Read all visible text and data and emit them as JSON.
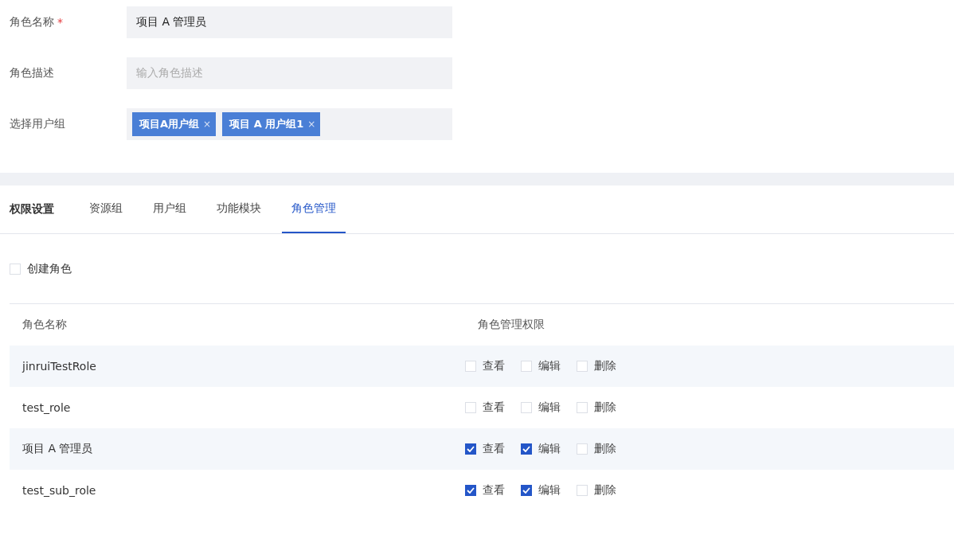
{
  "form": {
    "fields": [
      {
        "kind": "text",
        "label": "角色名称",
        "required_mark": "*",
        "value": "项目 A 管理员"
      },
      {
        "kind": "text",
        "label": "角色描述",
        "placeholder": "输入角色描述"
      },
      {
        "kind": "tags",
        "label": "选择用户组",
        "tags": [
          {
            "label": "项目A用户组",
            "remove": "×"
          },
          {
            "label": "项目 A 用户组1",
            "remove": "×"
          }
        ]
      }
    ]
  },
  "permissions": {
    "title": "权限设置",
    "tabs": [
      {
        "label": "资源组",
        "selected": false
      },
      {
        "label": "用户组",
        "selected": false
      },
      {
        "label": "功能模块",
        "selected": false
      },
      {
        "label": "角色管理",
        "selected": true
      }
    ],
    "create": {
      "label": "创建角色",
      "checked": false
    },
    "table": {
      "columns": [
        "角色名称",
        "角色管理权限"
      ],
      "rows": [
        {
          "name": "jinruiTestRole",
          "perms": [
            {
              "label": "查看",
              "checked": false
            },
            {
              "label": "编辑",
              "checked": false
            },
            {
              "label": "删除",
              "checked": false
            }
          ]
        },
        {
          "name": "test_role",
          "perms": [
            {
              "label": "查看",
              "checked": false
            },
            {
              "label": "编辑",
              "checked": false
            },
            {
              "label": "删除",
              "checked": false
            }
          ]
        },
        {
          "name": "项目 A 管理员",
          "perms": [
            {
              "label": "查看",
              "checked": true
            },
            {
              "label": "编辑",
              "checked": true
            },
            {
              "label": "删除",
              "checked": false
            }
          ]
        },
        {
          "name": "test_sub_role",
          "perms": [
            {
              "label": "查看",
              "checked": true
            },
            {
              "label": "编辑",
              "checked": true
            },
            {
              "label": "删除",
              "checked": false
            }
          ]
        }
      ]
    }
  }
}
